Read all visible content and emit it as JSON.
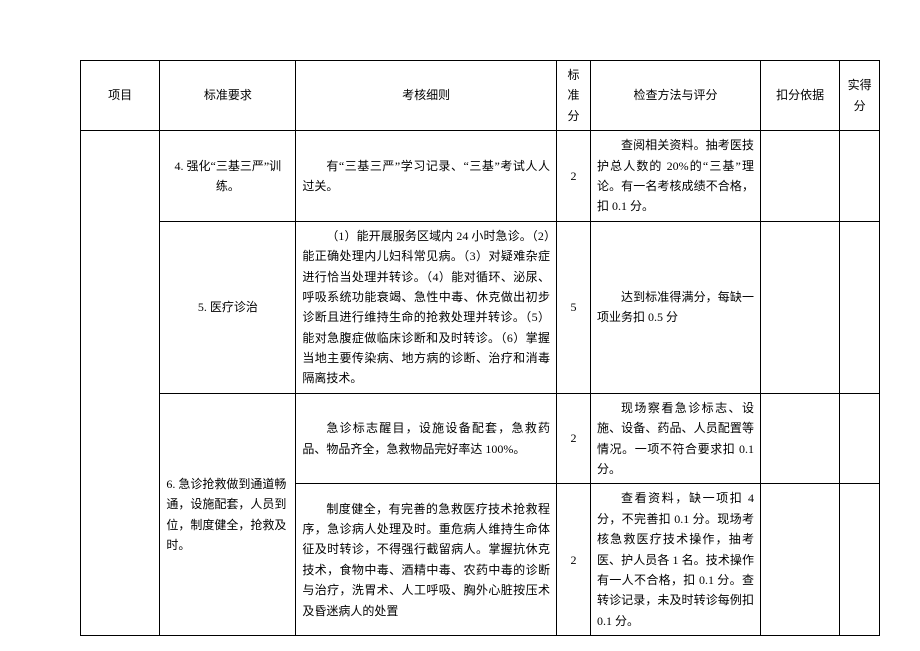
{
  "headers": {
    "project": "项目",
    "standard": "标准要求",
    "detail": "考核细则",
    "score": "标准分",
    "check": "检查方法与评分",
    "basis": "扣分依据",
    "actual": "实得分"
  },
  "rows": [
    {
      "standard": "4. 强化“三基三严”训练。",
      "detail": "有“三基三严”学习记录、“三基”考试人人过关。",
      "score": "2",
      "check": "查阅相关资料。抽考医技护总人数的 20%的“三基”理论。有一名考核成绩不合格，扣 0.1 分。"
    },
    {
      "standard": "5. 医疗诊治",
      "detail": "（1）能开展服务区域内 24 小时急诊。（2）能正确处理内儿妇科常见病。（3）对疑难杂症进行恰当处理并转诊。（4）能对循环、泌尿、呼吸系统功能衰竭、急性中毒、休克做出初步诊断且进行维持生命的抢救处理并转诊。（5）能对急腹症做临床诊断和及时转诊。（6）掌握当地主要传染病、地方病的诊断、治疗和消毒隔离技术。",
      "score": "5",
      "check": "达到标准得满分，每缺一项业务扣 0.5 分"
    },
    {
      "standard": "6. 急诊抢救做到通道畅通，设施配套，人员到位，制度健全，抢救及时。",
      "sub": [
        {
          "detail": "急诊标志醒目，设施设备配套，急救药品、物品齐全，急救物品完好率达 100%。",
          "score": "2",
          "check": "现场察看急诊标志、设施、设备、药品、人员配置等情况。一项不符合要求扣 0.1 分。"
        },
        {
          "detail": "制度健全，有完善的急救医疗技术抢救程序，急诊病人处理及时。重危病人维持生命体征及时转诊，不得强行截留病人。掌握抗休克技术，食物中毒、酒精中毒、农药中毒的诊断与治疗，洗胃术、人工呼吸、胸外心脏按压术及昏迷病人的处置",
          "score": "2",
          "check": "查看资料，缺一项扣 4 分，不完善扣 0.1 分。现场考核急救医疗技术操作，抽考医、护人员各 1 名。技术操作有一人不合格，扣 0.1 分。查转诊记录，未及时转诊每例扣 0.1 分。"
        }
      ]
    }
  ]
}
